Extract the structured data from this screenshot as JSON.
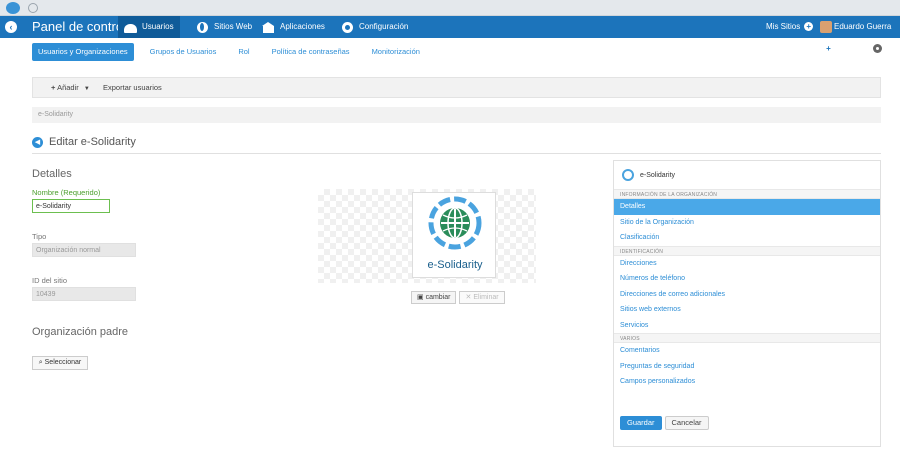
{
  "topbar": {
    "title": "Panel de control",
    "tabs": [
      {
        "label": "Usuarios",
        "icon": "users-icon"
      },
      {
        "label": "Sitios Web",
        "icon": "globe-icon"
      },
      {
        "label": "Aplicaciones",
        "icon": "store-icon"
      },
      {
        "label": "Configuración",
        "icon": "gear-icon"
      }
    ],
    "my_sites": "Mis Sitios",
    "user_name": "Eduardo Guerra"
  },
  "subnav": [
    "Usuarios y Organizaciones",
    "Grupos de Usuarios",
    "Rol",
    "Política de contraseñas",
    "Monitorización"
  ],
  "toolbar": {
    "add": "Añadir",
    "export": "Exportar usuarios"
  },
  "breadcrumb": "e-Solidarity",
  "edit_title": "Editar e-Solidarity",
  "form": {
    "section_details": "Detalles",
    "name_label": "Nombre (Requerido)",
    "name_value": "e-Solidarity",
    "type_label": "Tipo",
    "type_value": "Organización normal",
    "site_id_label": "ID del sitio",
    "site_id_value": "10439",
    "parent_section": "Organización padre",
    "select_button": "Seleccionar"
  },
  "logo": {
    "text": "e-Solidarity",
    "change_button": "cambiar",
    "delete_button": "Eliminar"
  },
  "panel": {
    "org_name": "e-Solidarity",
    "sections": [
      {
        "title": "INFORMACIÓN DE LA ORGANIZACIÓN",
        "links": [
          "Detalles",
          "Sitio de la Organización",
          "Clasificación"
        ]
      },
      {
        "title": "IDENTIFICACIÓN",
        "links": [
          "Direcciones",
          "Números de teléfono",
          "Direcciones de correo adicionales",
          "Sitios web externos",
          "Servicios"
        ]
      },
      {
        "title": "VARIOS",
        "links": [
          "Comentarios",
          "Preguntas de seguridad",
          "Campos personalizados"
        ]
      }
    ],
    "save": "Guardar",
    "cancel": "Cancelar"
  },
  "colors": {
    "accent": "#1c74bb",
    "link": "#2d8ed6",
    "active_link_bg": "#4aa8e8",
    "required_border": "#6cbf4f"
  }
}
